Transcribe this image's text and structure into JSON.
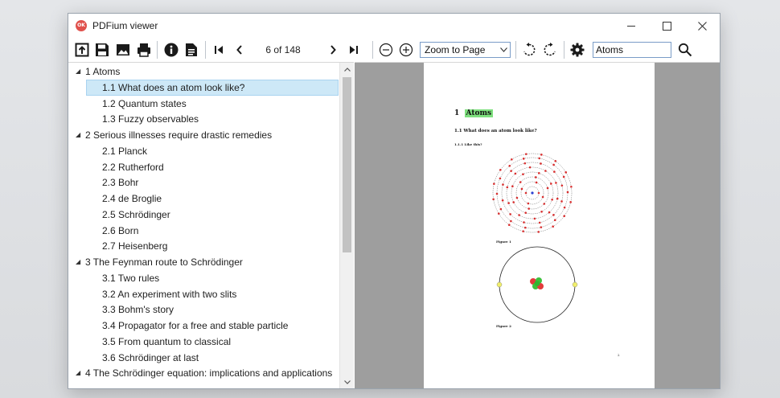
{
  "window": {
    "title": "PDFium viewer",
    "app_icon_text": "OK"
  },
  "toolbar": {
    "page_indicator": "6 of 148",
    "zoom_selected": "Zoom to Page",
    "search_value": "Atoms",
    "icons": [
      "open-icon",
      "save-icon",
      "image-icon",
      "print-icon",
      "info-icon",
      "document-icon",
      "first-page-icon",
      "previous-page-icon",
      "next-page-icon",
      "last-page-icon",
      "zoom-out-icon",
      "zoom-in-icon",
      "rotate-left-icon",
      "rotate-right-icon",
      "settings-icon",
      "search-icon"
    ]
  },
  "outline": {
    "items": [
      {
        "label": "1 Atoms",
        "level": 0,
        "expanded": true
      },
      {
        "label": "1.1 What does an atom look like?",
        "level": 1,
        "selected": true
      },
      {
        "label": "1.2 Quantum states",
        "level": 1
      },
      {
        "label": "1.3 Fuzzy observables",
        "level": 1
      },
      {
        "label": "2 Serious illnesses require drastic remedies",
        "level": 0,
        "expanded": true
      },
      {
        "label": "2.1 Planck",
        "level": 1
      },
      {
        "label": "2.2 Rutherford",
        "level": 1
      },
      {
        "label": "2.3 Bohr",
        "level": 1
      },
      {
        "label": "2.4 de Broglie",
        "level": 1
      },
      {
        "label": "2.5 Schrödinger",
        "level": 1
      },
      {
        "label": "2.6 Born",
        "level": 1
      },
      {
        "label": "2.7 Heisenberg",
        "level": 1
      },
      {
        "label": "3 The Feynman route to Schrödinger",
        "level": 0,
        "expanded": true
      },
      {
        "label": "3.1 Two rules",
        "level": 1
      },
      {
        "label": "3.2 An experiment with two slits",
        "level": 1
      },
      {
        "label": "3.3 Bohm's story",
        "level": 1
      },
      {
        "label": "3.4 Propagator for a free and stable particle",
        "level": 1
      },
      {
        "label": "3.5 From quantum to classical",
        "level": 1
      },
      {
        "label": "3.6 Schrödinger at last",
        "level": 1
      },
      {
        "label": "4 The Schrödinger equation: implications and applications",
        "level": 0,
        "expanded": true
      }
    ]
  },
  "page": {
    "heading_number": "1",
    "heading_text": "Atoms",
    "subheading": "1.1  What does an atom look like?",
    "subsubheading": "1.1.1  Like this?",
    "figure1_caption": "Figure 1",
    "figure2_caption": "Figure 2",
    "page_number": "2"
  },
  "colors": {
    "selection": "#cde8f7",
    "highlight": "#7ee07e",
    "viewer_background": "#9e9e9e",
    "app_icon": "#e0514c"
  }
}
